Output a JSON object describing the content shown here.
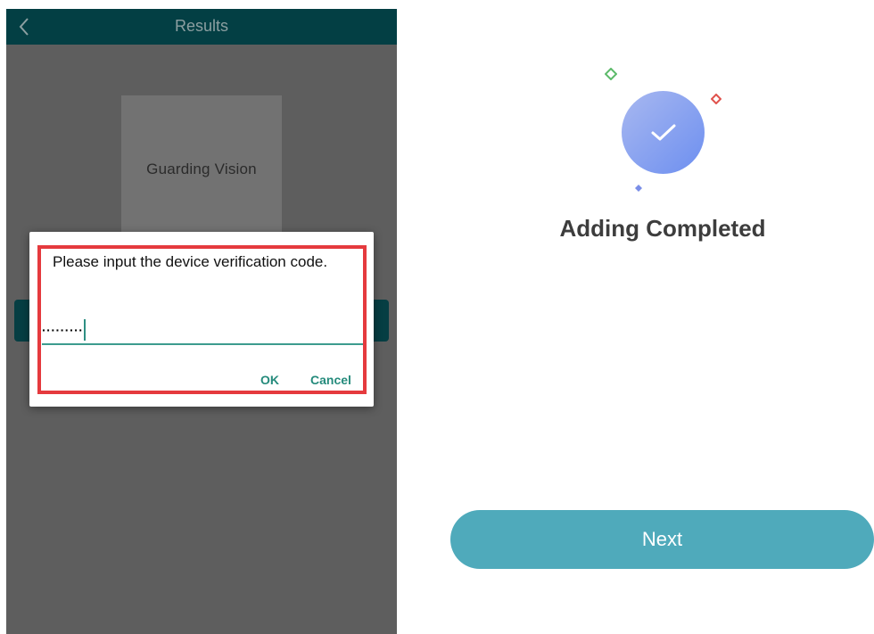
{
  "left_screen": {
    "header": {
      "title": "Results"
    },
    "brand": {
      "text": "Guarding Vision"
    },
    "dialog": {
      "message": "Please input the device verification code.",
      "code_value": "·········",
      "ok_label": "OK",
      "cancel_label": "Cancel"
    }
  },
  "right_screen": {
    "title": "Adding Completed",
    "next_label": "Next"
  },
  "colors": {
    "topbar": "#033f44",
    "accent_teal": "#258b7c",
    "highlight_red": "#e53a3e",
    "next_button": "#4faabb",
    "success_circle": "#7c97f0"
  },
  "icons": {
    "back": "chevron-left-icon",
    "success": "checkmark-icon"
  }
}
